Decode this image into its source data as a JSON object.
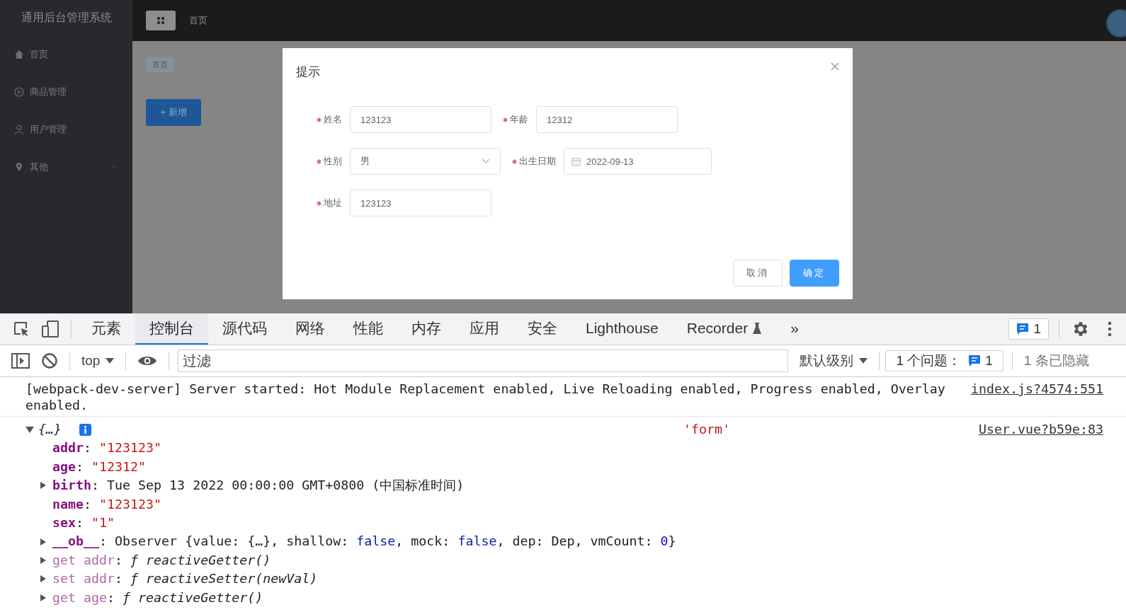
{
  "app": {
    "title": "通用后台管理系统",
    "nav": [
      {
        "label": "首页",
        "has_submenu": false
      },
      {
        "label": "商品管理",
        "has_submenu": false
      },
      {
        "label": "用户管理",
        "has_submenu": false
      },
      {
        "label": "其他",
        "has_submenu": true
      }
    ],
    "breadcrumb": "首页",
    "tag": "首页",
    "add_button": "+ 新增"
  },
  "dialog": {
    "title": "提示",
    "rows": [
      [
        {
          "label": "姓名",
          "required": true,
          "kind": "text",
          "value": "123123"
        },
        {
          "label": "年龄",
          "required": true,
          "kind": "text",
          "value": "12312"
        }
      ],
      [
        {
          "label": "性别",
          "required": true,
          "kind": "select",
          "value": "男"
        },
        {
          "label": "出生日期",
          "required": true,
          "kind": "date",
          "value": "2022-09-13"
        }
      ],
      [
        {
          "label": "地址",
          "required": true,
          "kind": "text",
          "value": "123123"
        }
      ]
    ],
    "buttons": [
      {
        "label": "取消",
        "kind": "default"
      },
      {
        "label": "确定",
        "kind": "primary"
      }
    ]
  },
  "devtools": {
    "tabs": [
      {
        "label": "元素",
        "selected": false
      },
      {
        "label": "控制台",
        "selected": true
      },
      {
        "label": "源代码",
        "selected": false
      },
      {
        "label": "网络",
        "selected": false
      },
      {
        "label": "性能",
        "selected": false
      },
      {
        "label": "内存",
        "selected": false
      },
      {
        "label": "应用",
        "selected": false
      },
      {
        "label": "安全",
        "selected": false
      },
      {
        "label": "Lighthouse",
        "selected": false
      },
      {
        "label": "Recorder",
        "selected": false
      }
    ],
    "more": "»",
    "issue_count": "1",
    "console_toolbar": {
      "context": "top",
      "filter_placeholder": "过滤",
      "level": "默认级别",
      "issues_label": "1 个问题：",
      "issues_count": "1",
      "hidden": "1 条已隐藏"
    },
    "messages": [
      {
        "kind": "text",
        "text": "[webpack-dev-server] Server started: Hot Module Replacement enabled, Live Reloading enabled, Progress enabled, Overlay enabled.",
        "source": "index.js?4574:551"
      },
      {
        "kind": "object",
        "summary": "{…}",
        "expanded": true,
        "label": "'form'",
        "source": "User.vue?b59e:83",
        "properties": [
          {
            "key": "addr",
            "kind": "own",
            "sep": ":",
            "expandable": false,
            "value": [
              {
                "text": "\"123123\"",
                "kind": "string"
              }
            ]
          },
          {
            "key": "age",
            "kind": "own",
            "sep": ":",
            "expandable": false,
            "value": [
              {
                "text": "\"12312\"",
                "kind": "string"
              }
            ]
          },
          {
            "key": "birth",
            "kind": "own",
            "sep": ":",
            "expandable": true,
            "value": [
              {
                "text": "Tue Sep 13 2022 00:00:00 GMT+0800 (中国标准时间)",
                "kind": "plain"
              }
            ]
          },
          {
            "key": "name",
            "kind": "own",
            "sep": ":",
            "expandable": false,
            "value": [
              {
                "text": "\"123123\"",
                "kind": "string"
              }
            ]
          },
          {
            "key": "sex",
            "kind": "own",
            "sep": ":",
            "expandable": false,
            "value": [
              {
                "text": "\"1\"",
                "kind": "string"
              }
            ]
          },
          {
            "key": "__ob__",
            "kind": "own",
            "sep": ":",
            "expandable": true,
            "value": [
              {
                "text": "Observer {value: {…}, shallow: ",
                "kind": "plain"
              },
              {
                "text": "false",
                "kind": "keyword"
              },
              {
                "text": ", mock: ",
                "kind": "plain"
              },
              {
                "text": "false",
                "kind": "keyword"
              },
              {
                "text": ", dep: Dep, vmCount: ",
                "kind": "plain"
              },
              {
                "text": "0",
                "kind": "number"
              },
              {
                "text": "}",
                "kind": "plain"
              }
            ]
          },
          {
            "key": "get addr",
            "kind": "accessor",
            "sep": ":",
            "expandable": true,
            "value": [
              {
                "text": "ƒ reactiveGetter()",
                "kind": "function"
              }
            ]
          },
          {
            "key": "set addr",
            "kind": "accessor",
            "sep": ":",
            "expandable": true,
            "value": [
              {
                "text": "ƒ reactiveSetter(newVal)",
                "kind": "function"
              }
            ]
          },
          {
            "key": "get age",
            "kind": "accessor",
            "sep": ":",
            "expandable": true,
            "value": [
              {
                "text": "ƒ reactiveGetter()",
                "kind": "function"
              }
            ]
          }
        ]
      }
    ]
  }
}
